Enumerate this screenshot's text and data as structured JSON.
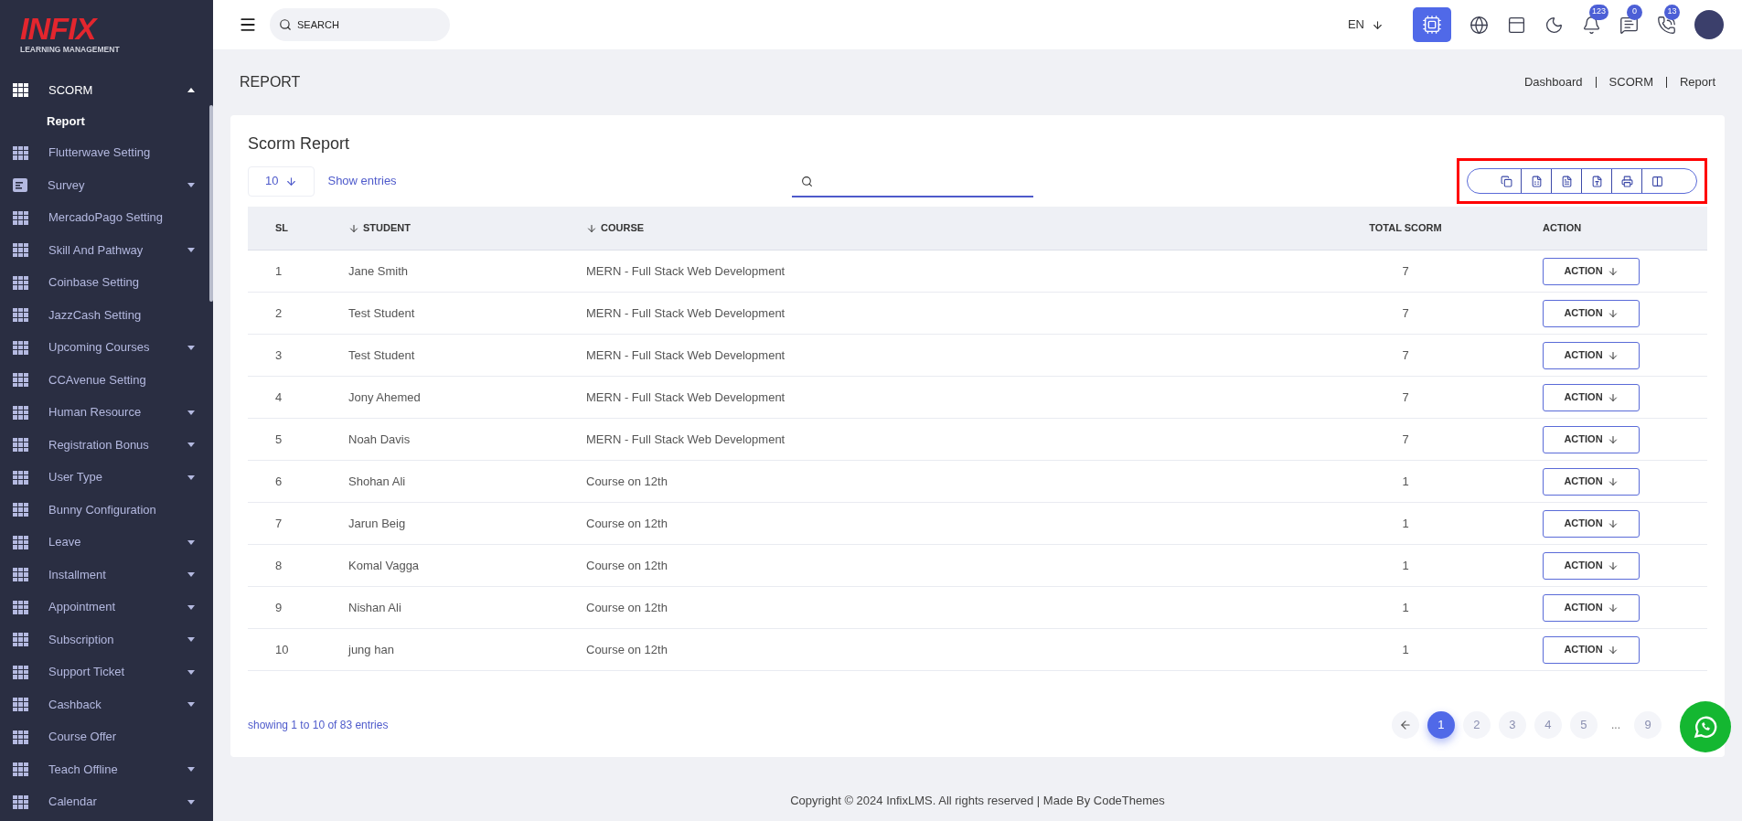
{
  "sidebar": {
    "logo": {
      "brand": "INFIX",
      "tagline": "LEARNING MANAGEMENT"
    },
    "items": [
      {
        "label": "SCORM",
        "kind": "grid",
        "expandable": true,
        "expanded": true,
        "selected": true,
        "children": [
          {
            "label": "Report",
            "selected": true
          }
        ]
      },
      {
        "label": "Flutterwave Setting",
        "kind": "grid",
        "expandable": false,
        "selected": false
      },
      {
        "label": "Survey",
        "kind": "list",
        "expandable": true,
        "expanded": false,
        "selected": false
      },
      {
        "label": "MercadoPago Setting",
        "kind": "grid",
        "expandable": false,
        "selected": false
      },
      {
        "label": "Skill And Pathway",
        "kind": "grid",
        "expandable": true,
        "expanded": false,
        "selected": false
      },
      {
        "label": "Coinbase Setting",
        "kind": "grid",
        "expandable": false,
        "selected": false
      },
      {
        "label": "JazzCash Setting",
        "kind": "grid",
        "expandable": false,
        "selected": false
      },
      {
        "label": "Upcoming Courses",
        "kind": "grid",
        "expandable": true,
        "expanded": false,
        "selected": false
      },
      {
        "label": "CCAvenue Setting",
        "kind": "grid",
        "expandable": false,
        "selected": false
      },
      {
        "label": "Human Resource",
        "kind": "grid",
        "expandable": true,
        "expanded": false,
        "selected": false
      },
      {
        "label": "Registration Bonus",
        "kind": "grid",
        "expandable": true,
        "expanded": false,
        "selected": false
      },
      {
        "label": "User Type",
        "kind": "grid",
        "expandable": true,
        "expanded": false,
        "selected": false
      },
      {
        "label": "Bunny Configuration",
        "kind": "grid",
        "expandable": false,
        "selected": false
      },
      {
        "label": "Leave",
        "kind": "grid",
        "expandable": true,
        "expanded": false,
        "selected": false
      },
      {
        "label": "Installment",
        "kind": "grid",
        "expandable": true,
        "expanded": false,
        "selected": false
      },
      {
        "label": "Appointment",
        "kind": "grid",
        "expandable": true,
        "expanded": false,
        "selected": false
      },
      {
        "label": "Subscription",
        "kind": "grid",
        "expandable": true,
        "expanded": false,
        "selected": false
      },
      {
        "label": "Support Ticket",
        "kind": "grid",
        "expandable": true,
        "expanded": false,
        "selected": false
      },
      {
        "label": "Cashback",
        "kind": "grid",
        "expandable": true,
        "expanded": false,
        "selected": false
      },
      {
        "label": "Course Offer",
        "kind": "grid",
        "expandable": false,
        "selected": false
      },
      {
        "label": "Teach Offline",
        "kind": "grid",
        "expandable": true,
        "expanded": false,
        "selected": false
      },
      {
        "label": "Calendar",
        "kind": "grid",
        "expandable": true,
        "expanded": false,
        "selected": false
      }
    ]
  },
  "top_bar": {
    "search": {
      "placeholder": "SEARCH"
    },
    "language": "EN",
    "ai_button": {
      "active": true
    },
    "icons": [
      {
        "kind": "globe"
      },
      {
        "kind": "layout"
      },
      {
        "kind": "moon"
      },
      {
        "kind": "bell",
        "badge": "123"
      },
      {
        "kind": "chat",
        "badge": "0"
      },
      {
        "kind": "phone-chat",
        "badge": "13"
      }
    ]
  },
  "page": {
    "title": "REPORT",
    "breadcrumbs": [
      "Dashboard",
      "SCORM",
      "Report"
    ]
  },
  "card": {
    "title": "Scorm Report",
    "page_size": "10",
    "show_entries": "Show entries",
    "export_toolbar": {
      "highlighted": true,
      "buttons": [
        {
          "kind": "copy"
        },
        {
          "kind": "excel"
        },
        {
          "kind": "csv"
        },
        {
          "kind": "pdf"
        },
        {
          "kind": "print"
        },
        {
          "kind": "columns"
        }
      ]
    },
    "table": {
      "columns": [
        {
          "label": "SL",
          "sortable": false
        },
        {
          "label": "STUDENT",
          "sortable": true
        },
        {
          "label": "COURSE",
          "sortable": true
        },
        {
          "label": "TOTAL SCORM",
          "sortable": false
        },
        {
          "label": "ACTION",
          "sortable": false
        }
      ],
      "rows": [
        {
          "sl": "1",
          "student": "Jane Smith",
          "course": "MERN - Full Stack Web Development",
          "total": "7",
          "action": "ACTION"
        },
        {
          "sl": "2",
          "student": "Test Student",
          "course": "MERN - Full Stack Web Development",
          "total": "7",
          "action": "ACTION"
        },
        {
          "sl": "3",
          "student": "Test Student",
          "course": "MERN - Full Stack Web Development",
          "total": "7",
          "action": "ACTION"
        },
        {
          "sl": "4",
          "student": "Jony Ahemed",
          "course": "MERN - Full Stack Web Development",
          "total": "7",
          "action": "ACTION"
        },
        {
          "sl": "5",
          "student": "Noah Davis",
          "course": "MERN - Full Stack Web Development",
          "total": "7",
          "action": "ACTION"
        },
        {
          "sl": "6",
          "student": "Shohan Ali",
          "course": "Course on 12th",
          "total": "1",
          "action": "ACTION"
        },
        {
          "sl": "7",
          "student": "Jarun Beig",
          "course": "Course on 12th",
          "total": "1",
          "action": "ACTION"
        },
        {
          "sl": "8",
          "student": "Komal Vagga",
          "course": "Course on 12th",
          "total": "1",
          "action": "ACTION"
        },
        {
          "sl": "9",
          "student": "Nishan Ali",
          "course": "Course on 12th",
          "total": "1",
          "action": "ACTION"
        },
        {
          "sl": "10",
          "student": "jung han",
          "course": "Course on 12th",
          "total": "1",
          "action": "ACTION"
        }
      ]
    },
    "summary": "showing 1 to 10 of 83 entries",
    "pagination": [
      {
        "label": "1",
        "selected": true
      },
      {
        "label": "2",
        "selected": false
      },
      {
        "label": "3",
        "selected": false
      },
      {
        "label": "4",
        "selected": false
      },
      {
        "label": "5",
        "selected": false
      },
      {
        "label": "...",
        "kind": "gap"
      },
      {
        "label": "9",
        "selected": false
      }
    ]
  },
  "footer": "Copyright © 2024 InfixLMS. All rights reserved | Made By CodeThemes"
}
